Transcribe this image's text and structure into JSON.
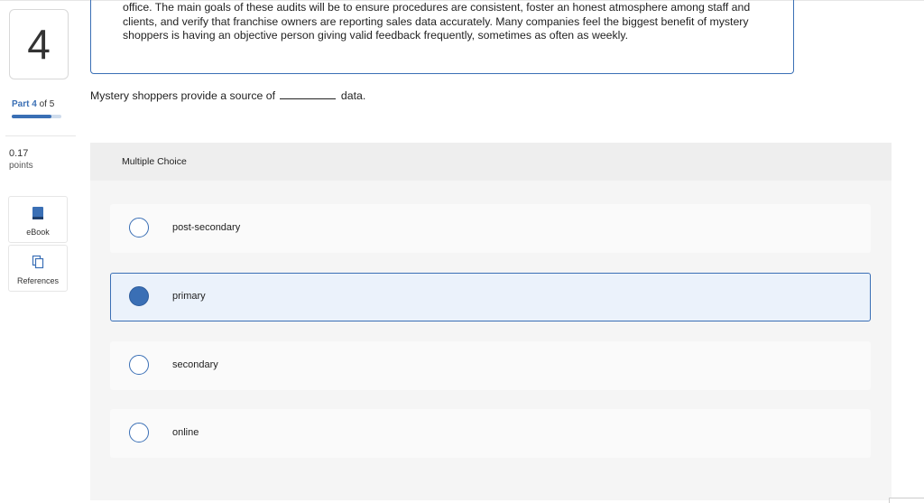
{
  "question": {
    "number": "4",
    "part_prefix": "Part",
    "part_current": "4",
    "part_of": "of 5",
    "progress_fraction": 0.8,
    "points_value": "0.17",
    "points_label": "points"
  },
  "tools": {
    "ebook_label": "eBook",
    "references_label": "References"
  },
  "passage": {
    "text": "office. The main goals of these audits will be to ensure procedures are consistent, foster an honest atmosphere among staff and clients, and verify that franchise owners are reporting sales data accurately. Many companies feel the biggest benefit of mystery shoppers is having an objective person giving valid feedback frequently, sometimes as often as weekly."
  },
  "prompt": {
    "before_blank": "Mystery shoppers provide a source of",
    "after_blank": "data."
  },
  "multiple_choice": {
    "header": "Multiple Choice",
    "options": [
      {
        "label": "post-secondary",
        "selected": false
      },
      {
        "label": "primary",
        "selected": true
      },
      {
        "label": "secondary",
        "selected": false
      },
      {
        "label": "online",
        "selected": false
      }
    ]
  },
  "colors": {
    "accent": "#3a6fb5",
    "selected_bg": "#ebf2fb",
    "panel_bg": "#f2f2f2"
  }
}
